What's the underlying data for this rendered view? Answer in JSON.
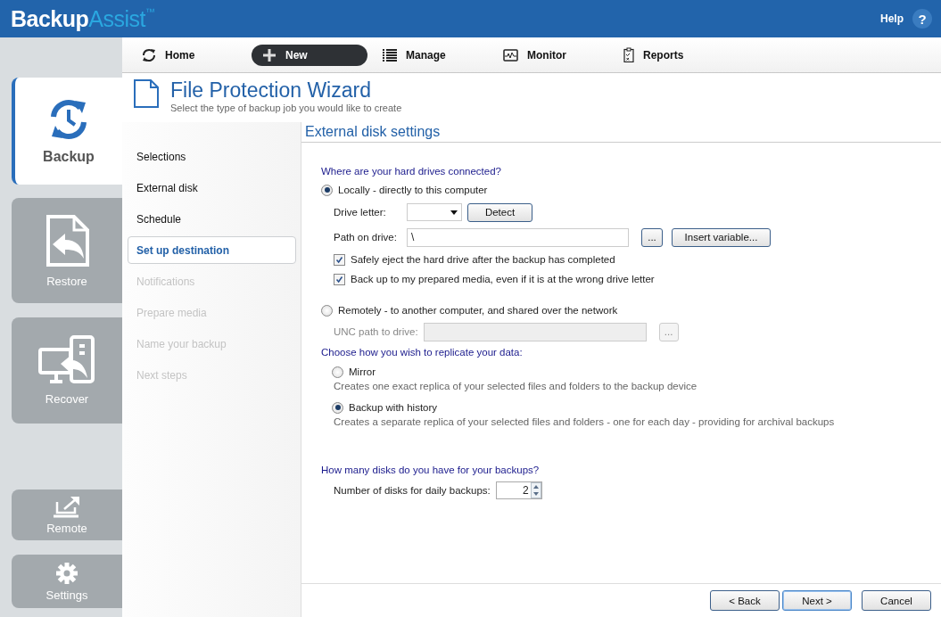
{
  "header": {
    "logo": {
      "primary": "Backup",
      "secondary": "Assist",
      "mark": "™"
    },
    "help": "Help",
    "help_icon": "?"
  },
  "sidebar": {
    "items": [
      {
        "label": "Backup",
        "kind": "backup",
        "selected": true
      },
      {
        "label": "Restore",
        "kind": "restore",
        "selected": false
      },
      {
        "label": "Recover",
        "kind": "recover",
        "selected": false
      },
      {
        "label": "Remote",
        "kind": "remote",
        "selected": false
      },
      {
        "label": "Settings",
        "kind": "settings",
        "selected": false
      }
    ]
  },
  "nav": {
    "items": [
      {
        "label": "Home",
        "kind": "home",
        "selected": false
      },
      {
        "label": "New",
        "kind": "new",
        "selected": true
      },
      {
        "label": "Manage",
        "kind": "manage",
        "selected": false
      },
      {
        "label": "Monitor",
        "kind": "monitor",
        "selected": false
      },
      {
        "label": "Reports",
        "kind": "reports",
        "selected": false
      }
    ]
  },
  "wizard": {
    "title": "File Protection Wizard",
    "subtitle": "Select the type of backup job you would like to create"
  },
  "steps": [
    {
      "label": "Selections",
      "selected": false,
      "disabled": false
    },
    {
      "label": "External disk",
      "selected": false,
      "disabled": false
    },
    {
      "label": "Schedule",
      "selected": false,
      "disabled": false
    },
    {
      "label": "Set up destination",
      "selected": true,
      "disabled": false
    },
    {
      "label": "Notifications",
      "selected": false,
      "disabled": true
    },
    {
      "label": "Prepare media",
      "selected": false,
      "disabled": true
    },
    {
      "label": "Name your backup",
      "selected": false,
      "disabled": true
    },
    {
      "label": "Next steps",
      "selected": false,
      "disabled": true
    }
  ],
  "page": {
    "heading": "External disk settings",
    "connection": {
      "question": "Where are your hard drives connected?",
      "local": {
        "label": "Locally - directly to this computer",
        "selected": true
      },
      "drive_letter": {
        "label": "Drive letter:"
      },
      "detect": "Detect",
      "path": {
        "label": "Path on drive:",
        "value": "\\"
      },
      "browse": "...",
      "insert_variable": "Insert variable...",
      "options": [
        {
          "label": "Safely eject the hard drive after the backup has completed",
          "checked": true
        },
        {
          "label": "Back up to my prepared media, even if it is at the wrong drive letter",
          "checked": true
        }
      ],
      "remote": {
        "label": "Remotely - to another computer, and shared over the network",
        "selected": false
      },
      "unc": {
        "label": "UNC path to drive:",
        "disabled": true
      },
      "unc_browse": "..."
    },
    "replication": {
      "question": "Choose how you wish to replicate your data:",
      "options": [
        {
          "label": "Mirror",
          "description": "Creates one exact replica of your selected files and folders to the backup device",
          "selected": false
        },
        {
          "label": "Backup with history",
          "description": "Creates a separate replica of your selected files and folders - one for each day - providing for archival backups",
          "selected": true
        }
      ]
    },
    "disks": {
      "question": "How many disks do you have for your backups?",
      "label": "Number of disks for daily backups:",
      "value": "2"
    }
  },
  "footer": {
    "buttons": [
      {
        "label": "< Back",
        "default": false
      },
      {
        "label": "Next >",
        "default": true
      },
      {
        "label": "Cancel",
        "default": false
      }
    ]
  }
}
